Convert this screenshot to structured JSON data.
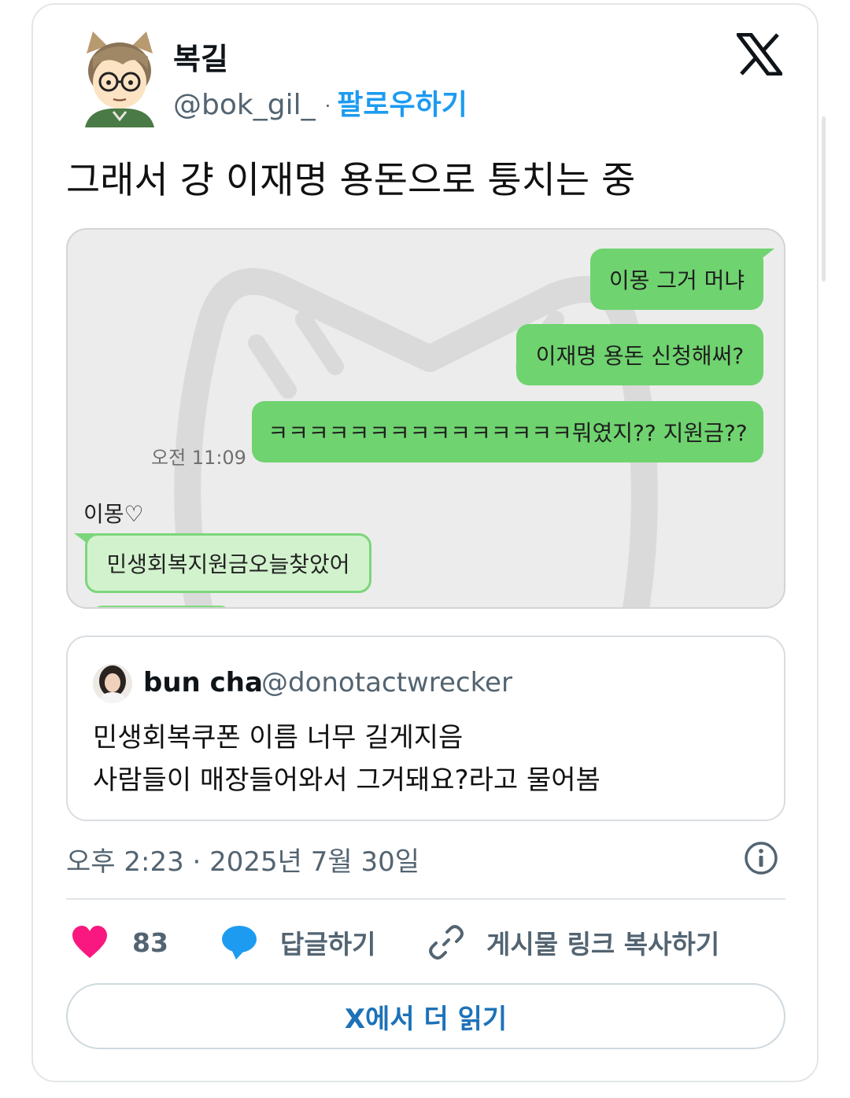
{
  "tweet": {
    "author": {
      "display_name": "복길",
      "handle": "@bok_gil_",
      "separator": "·",
      "follow_label": "팔로우하기"
    },
    "text": "그래서 걍 이재명 용돈으로 퉁치는 중",
    "platform_icon": "x-logo-icon"
  },
  "media": {
    "outgoing_messages": [
      "이몽 그거 머냐",
      "이재명 용돈 신청해써?",
      "ㅋㅋㅋㅋㅋㅋㅋㅋㅋㅋㅋㅋㅋㅋㅋ뭐였지?? 지원금??"
    ],
    "time": "오전 11:09",
    "sender_name": "이몽♡",
    "incoming_message": "민생회복지원금오늘찾았어",
    "colors": {
      "outgoing_bubble": "#6fd36f",
      "incoming_bubble": "#d2f2cd",
      "background": "#ececec"
    }
  },
  "quoted_tweet": {
    "display_name": "bun cha",
    "handle": "@donotactwrecker",
    "lines": [
      "민생회복쿠폰 이름 너무 길게지음",
      "사람들이 매장들어와서 그거돼요?라고 물어봄"
    ]
  },
  "timestamp": "오후 2:23 · 2025년 7월 30일",
  "actions": {
    "like_count": "83",
    "reply_label": "답글하기",
    "copy_link_label": "게시물 링크 복사하기"
  },
  "read_more_label": "X에서 더 읽기",
  "colors": {
    "accent": "#1d9bf0",
    "like": "#f91880",
    "reply": "#1d9bf0",
    "muted_text": "#536471"
  }
}
